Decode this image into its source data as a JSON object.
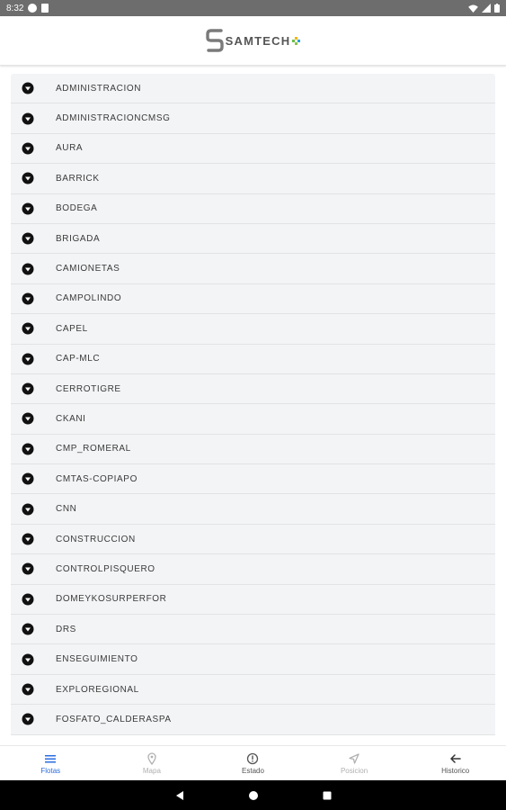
{
  "status_bar": {
    "time": "8:32"
  },
  "header": {
    "brand": "SAMTECH"
  },
  "fleets": [
    {
      "label": "ADMINISTRACION"
    },
    {
      "label": "ADMINISTRACIONCMSG"
    },
    {
      "label": "AURA"
    },
    {
      "label": "BARRICK"
    },
    {
      "label": "BODEGA"
    },
    {
      "label": "BRIGADA"
    },
    {
      "label": "CAMIONETAS"
    },
    {
      "label": "CAMPOLINDO"
    },
    {
      "label": "CAPEL"
    },
    {
      "label": "CAP-MLC"
    },
    {
      "label": "CERROTIGRE"
    },
    {
      "label": "CKANI"
    },
    {
      "label": "CMP_ROMERAL"
    },
    {
      "label": "CMTAS-COPIAPO"
    },
    {
      "label": "CNN"
    },
    {
      "label": "CONSTRUCCION"
    },
    {
      "label": "CONTROLPISQUERO"
    },
    {
      "label": "DOMEYKOSURPERFOR"
    },
    {
      "label": "DRS"
    },
    {
      "label": "ENSEGUIMIENTO"
    },
    {
      "label": "EXPLOREGIONAL"
    },
    {
      "label": "FOSFATO_CALDERASPA"
    }
  ],
  "bottom_nav": [
    {
      "label": "Flotas",
      "icon": "list-icon"
    },
    {
      "label": "Mapa",
      "icon": "map-pin-icon"
    },
    {
      "label": "Estado",
      "icon": "info-icon"
    },
    {
      "label": "Posicion",
      "icon": "navigation-icon"
    },
    {
      "label": "Historico",
      "icon": "arrow-left-icon"
    }
  ],
  "colors": {
    "accent": "#2b6de0",
    "row_background": "#f3f4f6",
    "status_bar": "#6d6d6d",
    "system_nav": "#000000"
  }
}
